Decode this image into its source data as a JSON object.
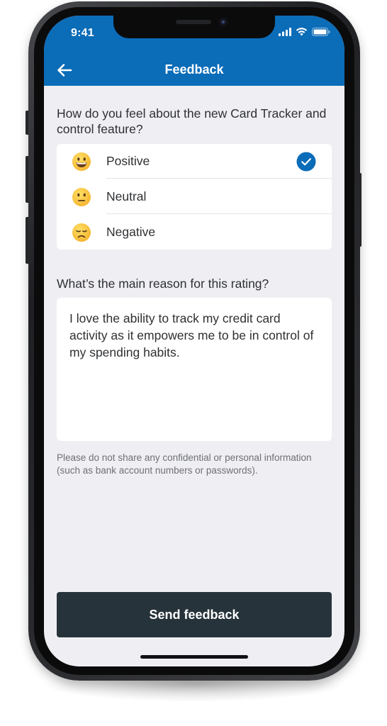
{
  "status_bar": {
    "time": "9:41"
  },
  "header": {
    "title": "Feedback",
    "back_icon": "arrow-left-icon",
    "background_color": "#0b6cb8"
  },
  "rating_question": "How do you feel about the new Card Tracker and control feature?",
  "options": [
    {
      "label": "Positive",
      "emoji": "grinning-face-icon",
      "selected": true
    },
    {
      "label": "Neutral",
      "emoji": "neutral-face-icon",
      "selected": false
    },
    {
      "label": "Negative",
      "emoji": "disappointed-face-icon",
      "selected": false
    }
  ],
  "reason_question": "What’s the main reason for this rating?",
  "reason_text": "I love the ability to track my credit card activity as it empowers me to be in control of my spending habits.",
  "disclaimer": "Please do not share any confidential or personal information (such as bank account numbers or passwords).",
  "send_button_label": "Send feedback",
  "colors": {
    "accent": "#0b6cb8",
    "button": "#27333a",
    "background": "#efeff3"
  }
}
